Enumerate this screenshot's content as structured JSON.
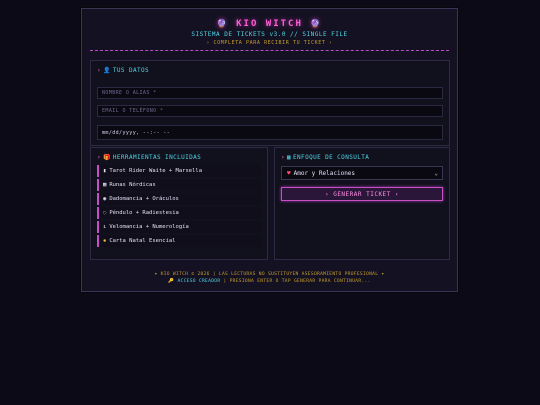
{
  "app": {
    "title": "KIO WITCH",
    "left_icon": "crystal-ball-icon",
    "right_icon": "crystal-ball-icon",
    "subtitle": "SISTEMA DE TICKETS v3.0 // SINGLE FILE",
    "hint": "› COMPLETA PARA RECIBIR TU TICKET ‹"
  },
  "datos": {
    "heading": "TUS DATOS",
    "nombre_placeholder": "NOMBRE O ALIAS *",
    "contacto_placeholder": "EMAIL O TELÉFONO *",
    "date_value": "mm/dd/yyyy, --:-- --"
  },
  "herramientas": {
    "heading": "HERRAMIENTAS INCLUIDAS",
    "items": [
      {
        "icon": "▮",
        "label": "Tarot Rider Waite + Marsella"
      },
      {
        "icon": "▦",
        "label": "Runas Nórdicas"
      },
      {
        "icon": "◉",
        "label": "Dadomancia + Oráculos"
      },
      {
        "icon": "◌",
        "label": "Péndulo + Radiestesia"
      },
      {
        "icon": "ı",
        "label": "Velomancia + Numerología"
      },
      {
        "icon": "✹",
        "label": "Carta Natal Esencial"
      }
    ]
  },
  "consulta": {
    "heading": "ENFOQUE DE CONSULTA",
    "selected": "Amor y Relaciones",
    "button": "› GENERAR TICKET ‹"
  },
  "footer": {
    "line1": "KIO WITCH © 2026 | LAS LECTURAS NO SUSTITUYEN ASESORAMIENTO PROFESIONAL",
    "access_label": "ACCESO CREADOR",
    "line2": "| PRESIONA ENTER O TAP GENERAR PARA CONTINUAR..."
  },
  "colors": {
    "accent_pink": "#ff5fd2",
    "accent_cyan": "#4fd6e6",
    "accent_gold": "#c79c2c",
    "background": "#0c0a16"
  }
}
